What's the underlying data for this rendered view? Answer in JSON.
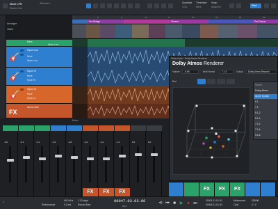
{
  "toolbar": {
    "song_title": "Mode LPR",
    "song_sub": "Studio One",
    "selector": "Standard",
    "quantize_label": "Quantize",
    "quantize_value": "1/16",
    "timebase_label": "Timebase",
    "timebase_value": "Bars",
    "snap_label": "Snap",
    "snap_value": "Adaptive",
    "start_label": "Start",
    "colors": {
      "blue": "#2f7fd0",
      "bg": "#2a2d31"
    }
  },
  "inspector": {
    "arranger": "Arranger",
    "video": "Video"
  },
  "tracks": [
    {
      "name": "Bass",
      "sub": [
        "Nylon Low"
      ],
      "color": "#2aa36a",
      "icon": "guitar-icon"
    },
    {
      "name": "Nylon Low",
      "sub": [
        "None",
        "Nylon Low"
      ],
      "color": "#2f7fd0",
      "icon": "guitar-icon"
    },
    {
      "name": "Nylon Hi",
      "sub": [
        "None",
        "Nylon Hi"
      ],
      "color": "#2f7fd0",
      "icon": "guitar-icon"
    },
    {
      "name": "Nylon Hi",
      "sub": [
        "None",
        "Nylon Lo"
      ],
      "color": "#d7662b",
      "icon": "guitar-icon"
    },
    {
      "name": "Atmos Bed",
      "sub": [
        "FX"
      ],
      "color": "#c5552a",
      "icon": "fx-icon"
    }
  ],
  "ruler": [
    "1",
    "5",
    "9",
    "13",
    "17",
    "21",
    "25",
    "29",
    "33"
  ],
  "markers": [
    {
      "label": "",
      "color": "#3a6fb7"
    },
    {
      "label": "Pre Bridge",
      "color": "#8c3fa0"
    },
    {
      "label": "",
      "color": "#b23a9b"
    },
    {
      "label": "Chorus",
      "color": "#9c3aa3"
    },
    {
      "label": "",
      "color": "#4a56b8"
    },
    {
      "label": "PreChorus",
      "color": "#8f3aa6"
    }
  ],
  "renderer": {
    "window_title": "Dolby Audio - Dolby Atmos Renderer",
    "logo": "Dolby Atmos",
    "logo_suffix": "Renderer",
    "volume_label": "Volume",
    "volume_value": "-6 dB",
    "bedformat_label": "Bed Format",
    "bedformat_value": "7.1.4",
    "output_label": "Output",
    "output_value": "Dolby Atmos Binaural",
    "bed_label": "Bed",
    "menu_header": "Stereo",
    "menu_options": [
      "Dolby Atmos",
      "Apple Spatial",
      "5.1",
      "7.1",
      "5.1.2",
      "5.1.4",
      "7.1.2",
      "7.1.4",
      "9.1.6"
    ],
    "menu_selected_index": 1
  },
  "mixer": {
    "title": "Mixer",
    "strips": [
      {
        "val": "-6.0",
        "color": "#2aa36a",
        "foot": ""
      },
      {
        "val": "-0.1",
        "color": "#2aa36a",
        "foot": ""
      },
      {
        "val": "-3.1",
        "color": "#2aa36a",
        "foot": ""
      },
      {
        "val": "-1.0",
        "color": "#2f7fd0",
        "foot": ""
      },
      {
        "val": "-2.8",
        "color": "#2f7fd0",
        "foot": ""
      },
      {
        "val": "-4.2",
        "color": "#c5552a",
        "foot": "FX"
      },
      {
        "val": "-4.2",
        "color": "#c5552a",
        "foot": "FX"
      },
      {
        "val": "-1.3",
        "color": "#c5552a",
        "foot": "FX"
      },
      {
        "val": "0.0",
        "color": "#3a3d42",
        "foot": ""
      },
      {
        "val": "0.0",
        "color": "#3a3d42",
        "foot": ""
      }
    ],
    "bottom": [
      "",
      "",
      "FX",
      "FX",
      "FX",
      "",
      ""
    ]
  },
  "transport": {
    "sample_rate": "48.0 kHz",
    "latency": "0.0 ms",
    "record_max": "2.13 days",
    "record_label": "Record Max",
    "performance_label": "Performance",
    "position": "00047.03.03.66",
    "position_label": "Bars",
    "duration": "00001.01.01.00",
    "end": "00004.01.01.00",
    "tempo": "120.00",
    "signature": "4 / 4",
    "metronome_label": "Metronome",
    "click_label": "Click"
  }
}
